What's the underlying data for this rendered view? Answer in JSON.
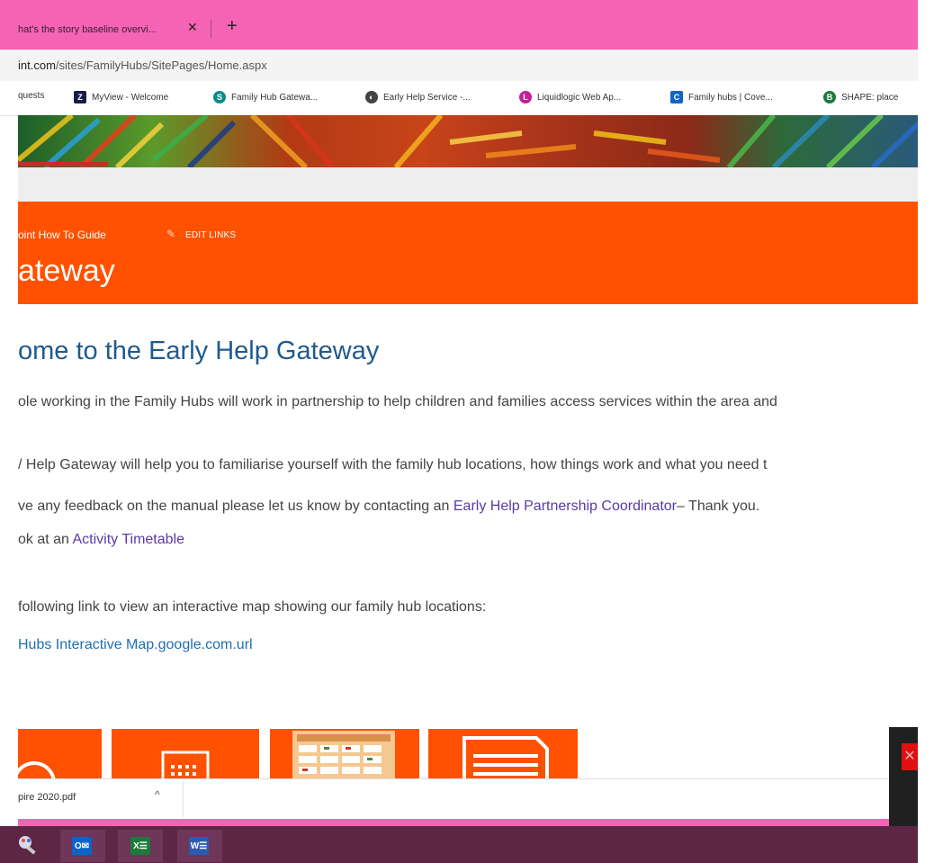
{
  "browser": {
    "tab_title": "hat's the story baseline overvi...",
    "tab_close": "✕",
    "new_tab": "+",
    "url_host": "int.com",
    "url_path": "/sites/FamilyHubs/SitePages/Home.aspx",
    "bookmarks": [
      {
        "label": "quests",
        "icon": "",
        "color": "#ffffff"
      },
      {
        "label": "MyView - Welcome",
        "icon": "Z",
        "color": "#1a1a4a"
      },
      {
        "label": "Family Hub Gatewa...",
        "icon": "S",
        "color": "#0f8a8a"
      },
      {
        "label": "Early Help Service -...",
        "icon": "◐",
        "color": "#444444"
      },
      {
        "label": "Liquidlogic Web Ap...",
        "icon": "L",
        "color": "#c21f9a"
      },
      {
        "label": "Family hubs | Cove...",
        "icon": "C",
        "color": "#1565c0"
      },
      {
        "label": "SHAPE: place",
        "icon": "B",
        "color": "#1e7a3c"
      }
    ]
  },
  "suite": {
    "nav_link": "oint How To Guide",
    "edit_links": "EDIT LINKS",
    "site_title": "ateway"
  },
  "content": {
    "heading": "ome to the Early Help Gateway",
    "p1": "ole working in the Family Hubs will work in partnership to help children and families access services within the area and",
    "p2": "/ Help Gateway will help you to familiarise yourself with the family hub locations, how things work and what you need t",
    "p3_pre": "ve any feedback on the manual please let us know by contacting an ",
    "p3_link": "Early Help Partnership Coordinator",
    "p3_post": "– Thank you.",
    "p4_pre": "ok at an ",
    "p4_link": "Activity Timetable",
    "p5": "following link to view an interactive map showing our family hub locations:",
    "p6_link": "Hubs Interactive Map.google.com.url"
  },
  "download": {
    "file_name": "pire 2020.pdf",
    "chevron": "^"
  },
  "taskbar": {
    "apps": [
      {
        "name": "Outlook",
        "glyph": "O✉",
        "color": "#0a64c8"
      },
      {
        "name": "Excel",
        "glyph": "X☰",
        "color": "#1e7a3c"
      },
      {
        "name": "Word",
        "glyph": "W☰",
        "color": "#2b5cb0"
      }
    ]
  },
  "colors": {
    "tab_bar": "#f564b4",
    "suite_orange": "#ff5100",
    "heading_blue": "#1f5a8f",
    "link_purple": "#5a3aa6",
    "taskbar": "#5c2644"
  }
}
